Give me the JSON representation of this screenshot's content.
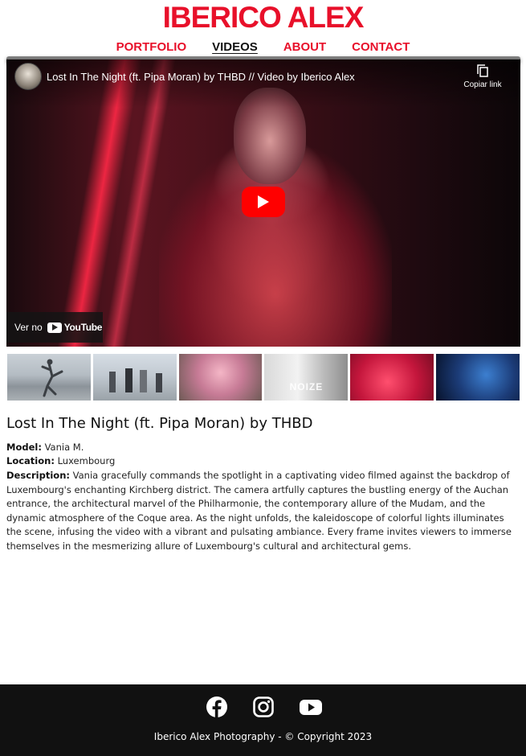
{
  "site": {
    "logo": "IBERICO ALEX"
  },
  "nav": {
    "items": [
      {
        "label": "PORTFOLIO",
        "active": false
      },
      {
        "label": "VIDEOS",
        "active": true
      },
      {
        "label": "ABOUT",
        "active": false
      },
      {
        "label": "CONTACT",
        "active": false
      }
    ]
  },
  "player": {
    "title": "Lost In The Night (ft. Pipa Moran) by THBD // Video by Iberico Alex",
    "copy_link_label": "Copiar link",
    "watch_on_label": "Ver no",
    "youtube_label": "YouTube",
    "icons": [
      "channel-avatar",
      "copy-icon",
      "play-icon",
      "youtube-icon"
    ]
  },
  "thumbnails": [
    {
      "name": "thumb-1",
      "caption": ""
    },
    {
      "name": "thumb-2",
      "caption": ""
    },
    {
      "name": "thumb-3",
      "caption": ""
    },
    {
      "name": "thumb-4",
      "caption": "NOIZE"
    },
    {
      "name": "thumb-5",
      "caption": ""
    },
    {
      "name": "thumb-6",
      "caption": ""
    }
  ],
  "post": {
    "title": "Lost In The Night (ft. Pipa Moran) by THBD",
    "model_label": "Model:",
    "model": "Vania M.",
    "location_label": "Location:",
    "location": "Luxembourg",
    "description_label": "Description:",
    "description": "Vania gracefully commands the spotlight in a captivating video filmed against the backdrop of Luxembourg's enchanting Kirchberg district. The camera artfully captures the bustling energy of the Auchan entrance, the architectural marvel of the Philharmonie, the contemporary allure of the Mudam, and the dynamic atmosphere of the Coque area. As the night unfolds, the kaleidoscope of colorful lights illuminates the scene, infusing the video with a vibrant and pulsating ambiance. Every frame invites viewers to immerse themselves in the mesmerizing allure of Luxembourg's cultural and architectural gems."
  },
  "footer": {
    "social_icons": [
      "facebook-icon",
      "instagram-icon",
      "youtube-icon"
    ],
    "copyright": "Iberico Alex Photography - © Copyright 2023"
  },
  "colors": {
    "brand_red": "#e8102a",
    "footer_bg": "#111111",
    "youtube_red": "#ff0000"
  }
}
